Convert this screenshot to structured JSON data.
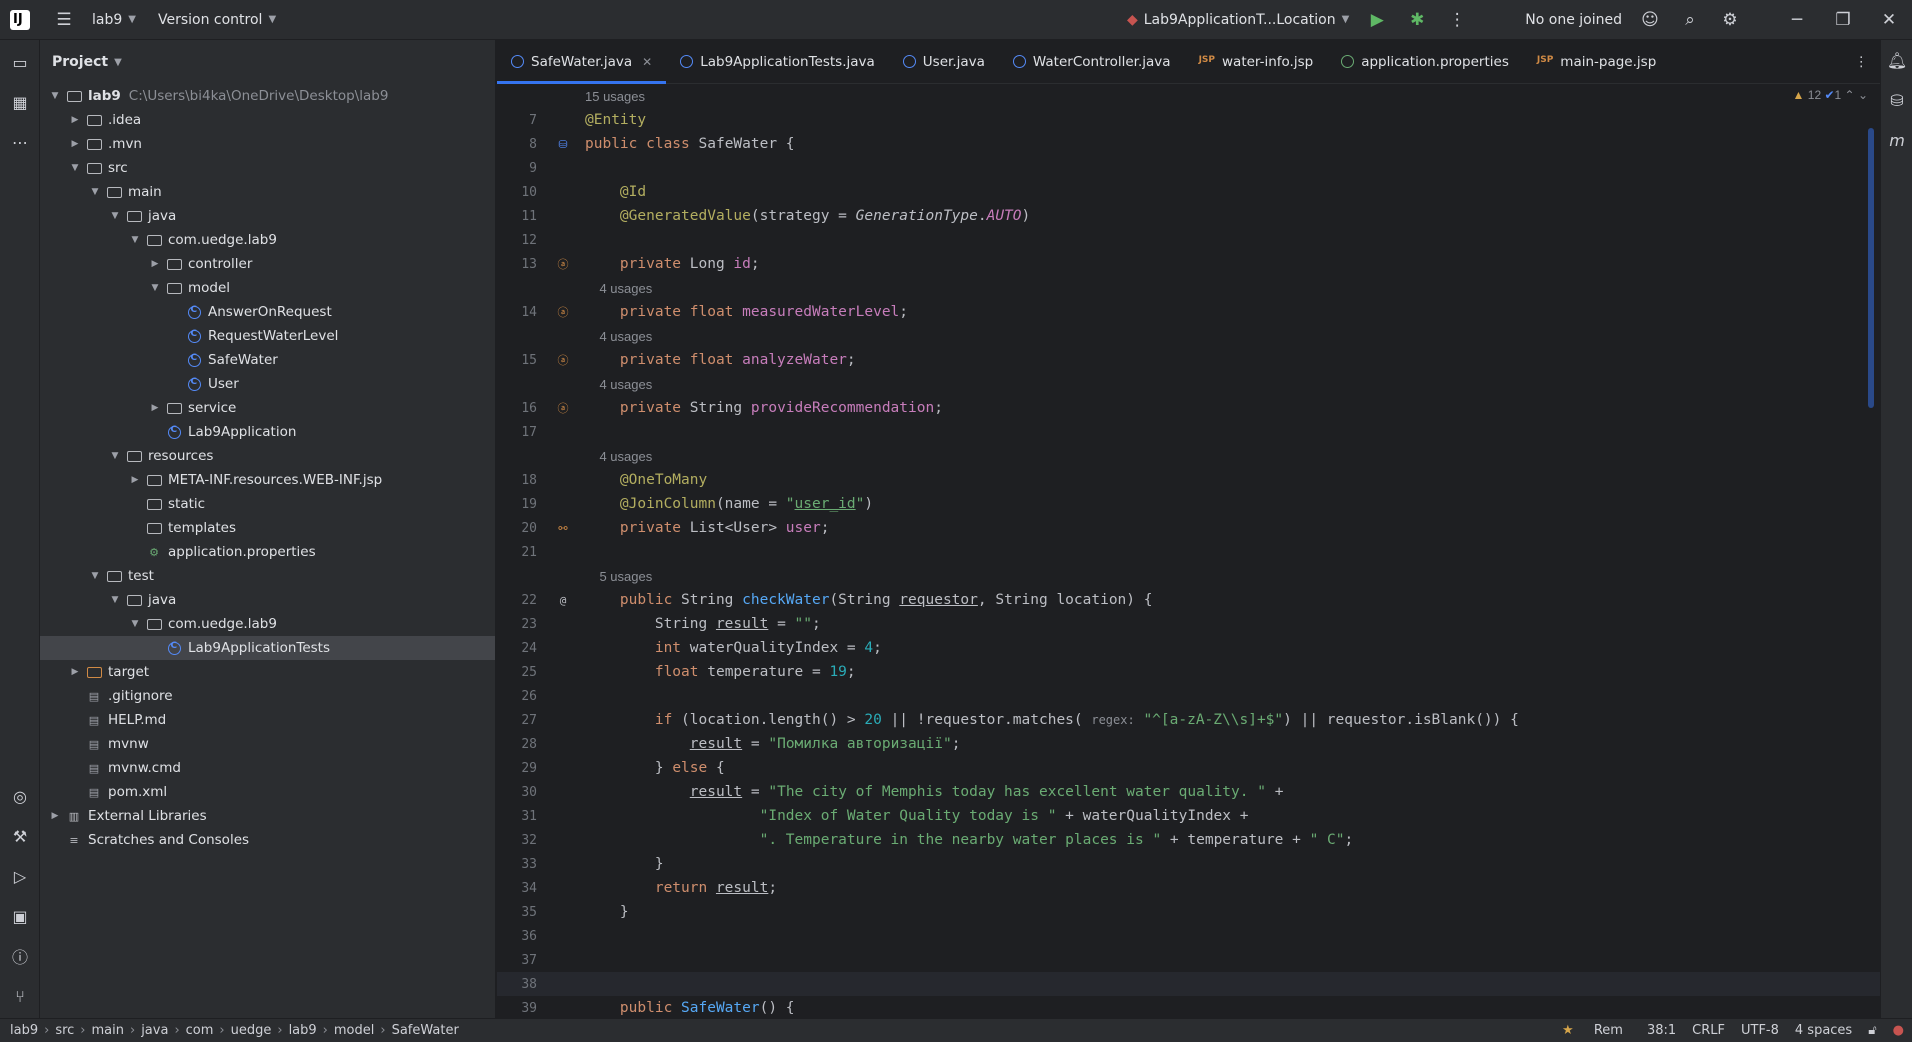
{
  "titlebar": {
    "project": "lab9",
    "vcs": "Version control",
    "run_config": "Lab9ApplicationT...Location",
    "collab": "No one joined"
  },
  "project_panel": {
    "title": "Project",
    "items": [
      {
        "label": "lab9",
        "extra": "C:\\Users\\bi4ka\\OneDrive\\Desktop\\lab9",
        "level": 0,
        "arrow": "down",
        "icon": "folder"
      },
      {
        "label": ".idea",
        "level": 1,
        "arrow": "right",
        "icon": "folder"
      },
      {
        "label": ".mvn",
        "level": 1,
        "arrow": "right",
        "icon": "folder"
      },
      {
        "label": "src",
        "level": 1,
        "arrow": "down",
        "icon": "folder"
      },
      {
        "label": "main",
        "level": 2,
        "arrow": "down",
        "icon": "folder"
      },
      {
        "label": "java",
        "level": 3,
        "arrow": "down",
        "icon": "folder"
      },
      {
        "label": "com.uedge.lab9",
        "level": 4,
        "arrow": "down",
        "icon": "folder"
      },
      {
        "label": "controller",
        "level": 5,
        "arrow": "right",
        "icon": "folder"
      },
      {
        "label": "model",
        "level": 5,
        "arrow": "down",
        "icon": "folder"
      },
      {
        "label": "AnswerOnRequest",
        "level": 6,
        "arrow": "",
        "icon": "class"
      },
      {
        "label": "RequestWaterLevel",
        "level": 6,
        "arrow": "",
        "icon": "class"
      },
      {
        "label": "SafeWater",
        "level": 6,
        "arrow": "",
        "icon": "class"
      },
      {
        "label": "User",
        "level": 6,
        "arrow": "",
        "icon": "class"
      },
      {
        "label": "service",
        "level": 5,
        "arrow": "right",
        "icon": "folder"
      },
      {
        "label": "Lab9Application",
        "level": 5,
        "arrow": "",
        "icon": "class"
      },
      {
        "label": "resources",
        "level": 3,
        "arrow": "down",
        "icon": "folder"
      },
      {
        "label": "META-INF.resources.WEB-INF.jsp",
        "level": 4,
        "arrow": "right",
        "icon": "folder"
      },
      {
        "label": "static",
        "level": 4,
        "arrow": "",
        "icon": "folder"
      },
      {
        "label": "templates",
        "level": 4,
        "arrow": "",
        "icon": "folder"
      },
      {
        "label": "application.properties",
        "level": 4,
        "arrow": "",
        "icon": "prop"
      },
      {
        "label": "test",
        "level": 2,
        "arrow": "down",
        "icon": "folder"
      },
      {
        "label": "java",
        "level": 3,
        "arrow": "down",
        "icon": "folder"
      },
      {
        "label": "com.uedge.lab9",
        "level": 4,
        "arrow": "down",
        "icon": "folder"
      },
      {
        "label": "Lab9ApplicationTests",
        "level": 5,
        "arrow": "",
        "icon": "class",
        "selected": true
      },
      {
        "label": "target",
        "level": 1,
        "arrow": "right",
        "icon": "folder-orange"
      },
      {
        "label": ".gitignore",
        "level": 1,
        "arrow": "",
        "icon": "file"
      },
      {
        "label": "HELP.md",
        "level": 1,
        "arrow": "",
        "icon": "file"
      },
      {
        "label": "mvnw",
        "level": 1,
        "arrow": "",
        "icon": "file"
      },
      {
        "label": "mvnw.cmd",
        "level": 1,
        "arrow": "",
        "icon": "file"
      },
      {
        "label": "pom.xml",
        "level": 1,
        "arrow": "",
        "icon": "file"
      },
      {
        "label": "External Libraries",
        "level": 0,
        "arrow": "right",
        "icon": "lib"
      },
      {
        "label": "Scratches and Consoles",
        "level": 0,
        "arrow": "",
        "icon": "scratch"
      }
    ]
  },
  "tabs": [
    {
      "label": "SafeWater.java",
      "active": true,
      "icon": "class"
    },
    {
      "label": "Lab9ApplicationTests.java",
      "icon": "class"
    },
    {
      "label": "User.java",
      "icon": "class"
    },
    {
      "label": "WaterController.java",
      "icon": "class"
    },
    {
      "label": "water-info.jsp",
      "icon": "jsp"
    },
    {
      "label": "application.properties",
      "icon": "prop"
    },
    {
      "label": "main-page.jsp",
      "icon": "jsp"
    }
  ],
  "inspections": {
    "warnings": "12",
    "checks": "1"
  },
  "status": {
    "crumbs": [
      "lab9",
      "src",
      "main",
      "java",
      "com",
      "uedge",
      "lab9",
      "model",
      "SafeWater"
    ],
    "rem": "Rem",
    "position": "38:1",
    "line_sep": "CRLF",
    "encoding": "UTF-8",
    "indent": "4 spaces"
  }
}
